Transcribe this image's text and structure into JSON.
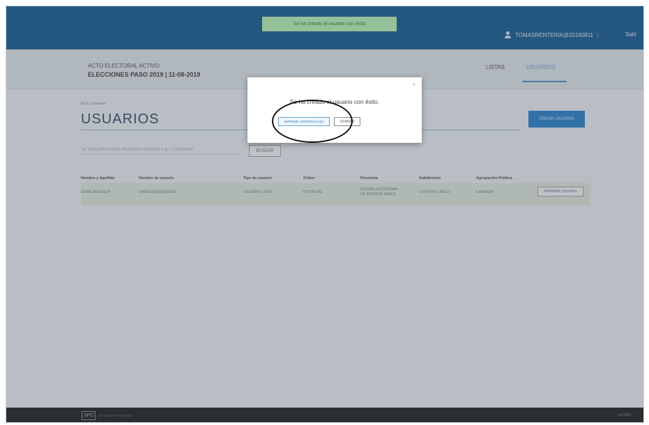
{
  "topbar": {
    "toast": "Se ha creado el usuario con éxito",
    "user_email": "TOMASRENTERIA@20190811",
    "separator": "|",
    "logout_label": "Salir"
  },
  "header": {
    "acto_label": "ACTO ELECTORAL ACTIVO",
    "eleccion_label": "ELECCIONES PASO 2019 | 11-08-2019",
    "nav": {
      "listas": "LISTAS",
      "usuarios": "USUARIOS"
    }
  },
  "main": {
    "breadcrumb": "Inicio / Usuarios",
    "title": "USUARIOS",
    "create_button": "CREAR USUARIO",
    "search_placeholder": "Ej. ENCARNACIÓN, MARIANO FRANCO o @ 1231234588",
    "search_button": "BUSCAR"
  },
  "table": {
    "headers": [
      "Nombre y Apellido",
      "Nombre de usuario",
      "Tipo de usuario",
      "Orden",
      "Provincia",
      "Subdivisión",
      "Agrupación Política"
    ],
    "rows": [
      {
        "nombre": "DIANCAVESSUP",
        "usuario": "DIANCAVE@2019081",
        "tipo": "USUARIO LISTA",
        "orden": "DISTRITAL",
        "provincia_1": "CIUDAD AUTÓNOMA",
        "provincia_2": "DE BUENOS AIRES",
        "subdivision": "DISTRITO ÚNICO",
        "agrupacion": "LAVANDA",
        "action": "IMPRIMIR USUARIO"
      }
    ]
  },
  "modal": {
    "close": "×",
    "message": "Se ha creado el usuario con éxito.",
    "print_button": "IMPRIMIR CREDENCIALES",
    "close_button": "CERRAR"
  },
  "footer": {
    "logo": "SPC",
    "logo_text": "SISTEMA DE PRESENTACIÓN",
    "copyright": "(c) 2019"
  }
}
